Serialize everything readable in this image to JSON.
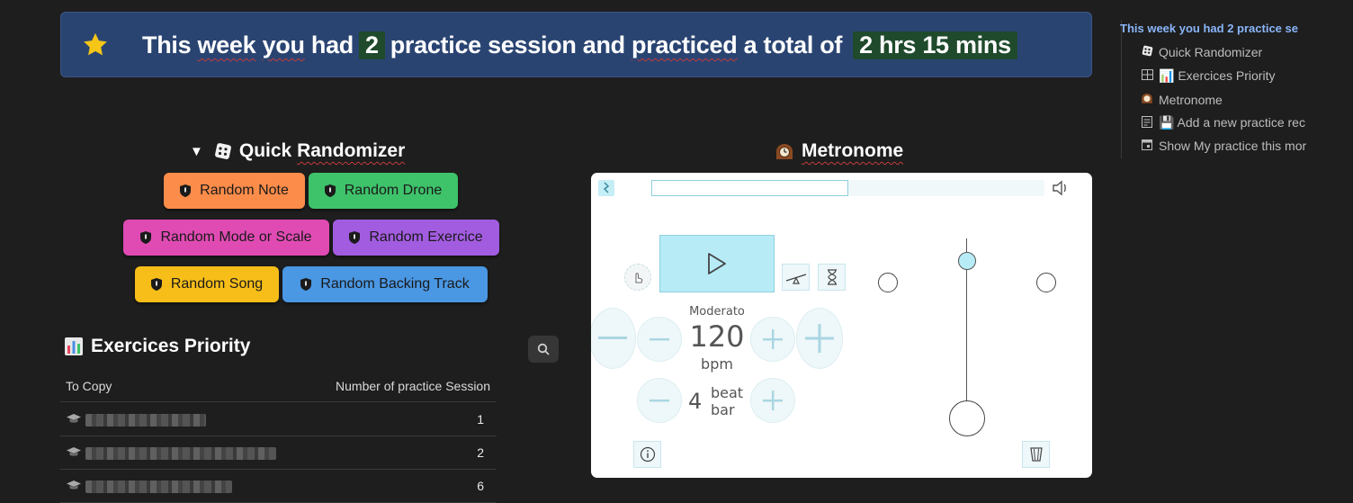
{
  "banner": {
    "icon": "star-icon",
    "text_1": "This",
    "text_2": "week",
    "text_3": "you",
    "text_4": "had",
    "sessions": "2",
    "text_5": "practice session and",
    "text_6": "practiced",
    "text_7": "a total of",
    "total_time": "2 hrs 15 mins",
    "highlight_color": "#1f4a2c",
    "background_color": "#2a4472"
  },
  "randomizer": {
    "toggle": "▼",
    "icon": "dice-icon",
    "title_a": "Quick",
    "title_b": "Randomizer",
    "buttons": [
      {
        "label": "Random Note",
        "color": "#fb8c4a"
      },
      {
        "label": "Random Drone",
        "color": "#3ec26a"
      },
      {
        "label": "Random Mode or Scale",
        "color": "#e04bb3"
      },
      {
        "label": "Random Exercice",
        "color": "#a25ce0"
      },
      {
        "label": "Random Song",
        "color": "#f7be19"
      },
      {
        "label": "Random Backing Track",
        "color": "#4a97e3"
      }
    ]
  },
  "priority": {
    "icon": "bar-chart-icon",
    "title": "Exercices Priority",
    "columns": [
      "To Copy",
      "Number of practice Session"
    ],
    "rows": [
      {
        "count": "1"
      },
      {
        "count": "2"
      },
      {
        "count": "6"
      }
    ]
  },
  "metronome": {
    "icon": "mantelpiece-clock-icon",
    "title": "Metronome",
    "tempo_marking": "Moderato",
    "bpm": "120",
    "bpm_label": "bpm",
    "beats": "4",
    "beat_label_1": "beat",
    "beat_label_2": "bar",
    "progress": 0.5,
    "accent_color": "#b7ecf7"
  },
  "outline": {
    "title": "This week you had 2 practice se",
    "items": [
      {
        "icon": "dice-icon",
        "label": "Quick Randomizer"
      },
      {
        "icon": "table-icon",
        "label": "📊 Exercices Priority"
      },
      {
        "icon": "mantelpiece-clock-icon",
        "label": "Metronome"
      },
      {
        "icon": "form-icon",
        "label": "💾 Add a new practice rec"
      },
      {
        "icon": "calendar-icon",
        "label": "Show My practice this mor"
      }
    ]
  }
}
